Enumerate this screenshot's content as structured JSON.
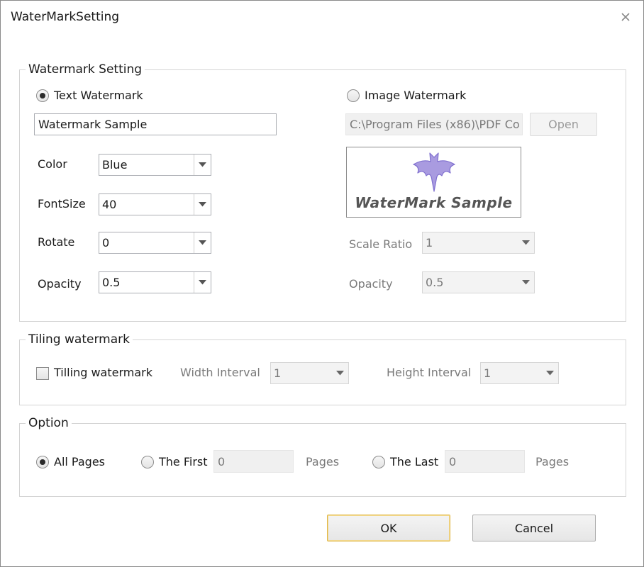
{
  "window": {
    "title": "WaterMarkSetting"
  },
  "watermark_setting": {
    "legend": "Watermark Setting",
    "text_watermark": {
      "label": "Text Watermark",
      "checked": true,
      "value": "Watermark Sample"
    },
    "image_watermark": {
      "label": "Image Watermark",
      "checked": false,
      "path": "C:\\Program Files (x86)\\PDF Co",
      "open_label": "Open",
      "preview_text": "WaterMark Sample"
    },
    "color": {
      "label": "Color",
      "value": "Blue"
    },
    "font_size": {
      "label": "FontSize",
      "value": "40"
    },
    "rotate": {
      "label": "Rotate",
      "value": "0"
    },
    "opacity": {
      "label": "Opacity",
      "value": "0.5"
    },
    "scale_ratio": {
      "label": "Scale Ratio",
      "value": "1"
    },
    "image_opacity": {
      "label": "Opacity",
      "value": "0.5"
    }
  },
  "tiling": {
    "legend": "Tiling watermark",
    "checkbox_label": "Tilling watermark",
    "checked": false,
    "width_interval": {
      "label": "Width Interval",
      "value": "1"
    },
    "height_interval": {
      "label": "Height Interval",
      "value": "1"
    }
  },
  "option": {
    "legend": "Option",
    "all_pages": {
      "label": "All Pages",
      "checked": true
    },
    "the_first": {
      "label": "The First",
      "value": "0",
      "suffix": "Pages"
    },
    "the_last": {
      "label": "The Last",
      "value": "0",
      "suffix": "Pages"
    }
  },
  "buttons": {
    "ok": "OK",
    "cancel": "Cancel"
  },
  "colors": {
    "accent_border": "#e0b84a",
    "bat_fill": "#a99be0",
    "bat_stroke": "#7f6fcf"
  }
}
